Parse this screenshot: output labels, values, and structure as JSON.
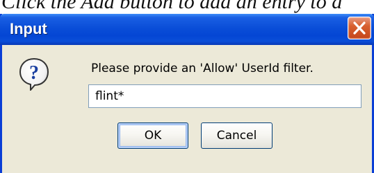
{
  "background": {
    "caption": "Click the Add button to add an entry to a"
  },
  "dialog": {
    "title": "Input",
    "close_icon": "close-icon",
    "message_icon": "question-icon",
    "prompt": "Please provide an 'Allow' UserId filter.",
    "input_value": "flint*",
    "ok_label": "OK",
    "cancel_label": "Cancel"
  },
  "colors": {
    "titlebar": "#0a4ed8",
    "window_bg": "#ece9d8",
    "close_button": "#d8602f",
    "input_border": "#7f9db9",
    "button_border": "#003c74"
  }
}
